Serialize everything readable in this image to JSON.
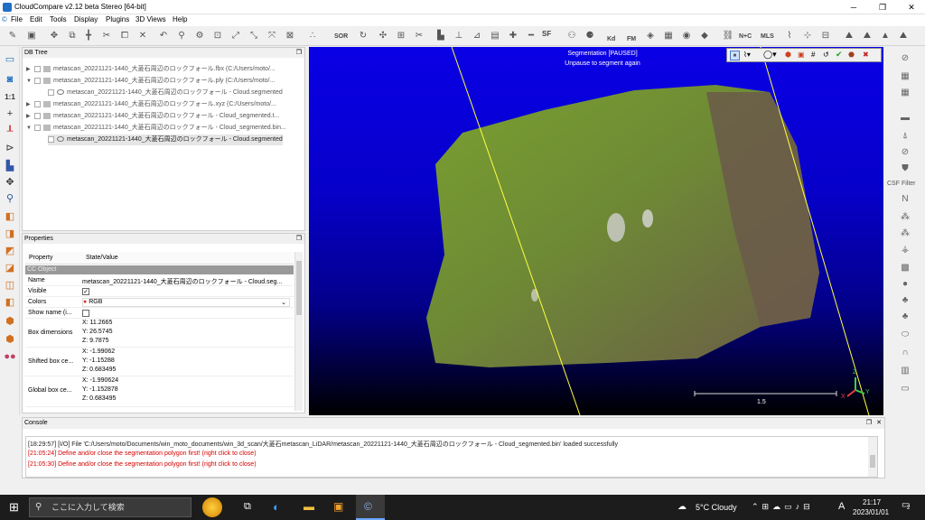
{
  "app": {
    "title": "CloudCompare v2.12 beta Stereo [64-bit]"
  },
  "menu": [
    "File",
    "Edit",
    "Tools",
    "Display",
    "Plugins",
    "3D Views",
    "Help"
  ],
  "toolbar": {
    "sor": "SOR",
    "sf": "SF",
    "nc": "N+C",
    "mls": "MLS",
    "kd": "Kd",
    "fm": "FM"
  },
  "dbtree": {
    "title": "DB Tree",
    "items": [
      "metascan_20221121-1440_大菱石周辺のロックフォール.fbx (C:/Users/moto/...",
      "metascan_20221121-1440_大菱石周辺のロックフォール.ply (C:/Users/moto/...",
      "metascan_20221121-1440_大菱石周辺のロックフォール - Cloud.segmented",
      "metascan_20221121-1440_大菱石周辺のロックフォール.xyz (C:/Users/moto/...",
      "metascan_20221121-1440_大菱石周辺のロックフォール - Cloud_segmented.t...",
      "metascan_20221121-1440_大菱石周辺のロックフォール - Cloud_segmented.bin...",
      "metascan_20221121-1440_大菱石周辺のロックフォール - Cloud.segmented"
    ]
  },
  "props": {
    "title": "Properties",
    "col1": "Property",
    "col2": "State/Value",
    "section": "CC Object",
    "name_k": "Name",
    "name_v": "metascan_20221121-1440_大菱石周辺のロックフォール - Cloud.seg...",
    "visible_k": "Visible",
    "colors_k": "Colors",
    "colors_v": "RGB",
    "showname_k": "Show name (i...",
    "box_k": "Box dimensions",
    "box_x": "X: 11.2665",
    "box_y": "Y: 26.5745",
    "box_z": "Z: 9.7875",
    "shift_k": "Shifted box ce...",
    "shift_x": "X: -1.99062",
    "shift_y": "Y: -1.15288",
    "shift_z": "Z: 0.683495",
    "glob_k": "Global box ce...",
    "glob_x": "X: -1.990624",
    "glob_y": "Y: -1.152878",
    "glob_z": "Z: 0.683495"
  },
  "viewport": {
    "seg1": "Segmentation [PAUSED]",
    "seg2": "Unpause to segment again",
    "scale": "1.5",
    "axis_z": "Z",
    "axis_y": "Y",
    "axis_x": "X"
  },
  "right": {
    "csf": "CSF Filter"
  },
  "console": {
    "title": "Console",
    "lines": [
      {
        "text": "[18:29:57] [I/O] File 'C:/Users/moto/Documents/win_moto_documents/win_3d_scan/大菱石metascan_LiDAR/metascan_20221121-1440_大菱石周辺のロックフォール - Cloud_segmented.bin' loaded successfully",
        "color": "#222222"
      },
      {
        "text": "[21:05:24] Define and/or close the segmentation polygon first! (right click to close)",
        "color": "#d40000"
      },
      {
        "text": "[21:05:30] Define and/or close the segmentation polygon first! (right click to close)",
        "color": "#d40000"
      }
    ]
  },
  "taskbar": {
    "search": "ここに入力して検索",
    "weather": "5°C Cloudy",
    "ime": "A",
    "time": "21:17",
    "date": "2023/01/01",
    "notif": "2"
  }
}
